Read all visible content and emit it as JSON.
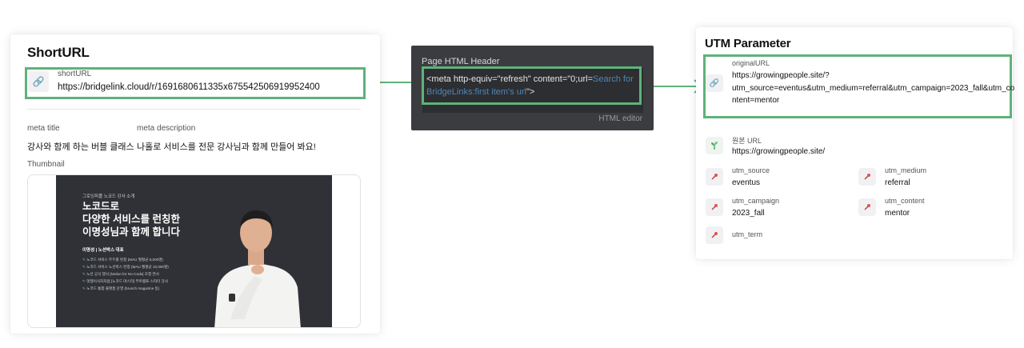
{
  "short_card": {
    "title": "ShortURL",
    "short_url": {
      "label": "shortURL",
      "value": "https://bridgelink.cloud/r/1691680611335x675542506919952400"
    },
    "meta_title": {
      "label": "meta title",
      "value": "강사와 함께 하는 버블 클래스"
    },
    "meta_description": {
      "label": "meta description",
      "value": "나홀로 서비스를 전문 강사님과 함께 만들어 봐요!"
    },
    "thumbnail": {
      "label": "Thumbnail",
      "eyebrow": "그로잉피플 노코드 강사 소개",
      "headline": [
        "노코드로",
        "다양한 서비스를 런칭한",
        "이명성님과 함께 합니다"
      ],
      "name": "이명성 | 노션박스 대표",
      "bullets": [
        "노코드 서비스 뚜두를 런칭 (MAU 월평균 5,000명)",
        "노코드 서비스 노션박스 런칭 (MAU 월평균 10,000명)",
        "노션 공식 행사 [Notion for No-Code] 초청 연사",
        "멋쟁이사자처럼 [노코드 마스터] 부트캠프 스타터 강사",
        "노코드 통합 플랫폼 운영 (brunch magazine 등)"
      ]
    }
  },
  "editor": {
    "title": "Page HTML Header",
    "code_plain": "<meta http-equiv=\"refresh\" content=\"0;url=",
    "code_link": "Search for BridgeLinks:first item's url",
    "code_end": "\">",
    "footer": "HTML editor"
  },
  "utm_card": {
    "title": "UTM Parameter",
    "original_url": {
      "label": "originalURL",
      "lines": [
        "https://growingpeople.site/?",
        "utm_source=eventus&utm_medium=referral&utm_campaign=2023_fall&utm_co",
        "ntent=mentor"
      ]
    },
    "origin_url": {
      "label": "원본 URL",
      "value": "https://growingpeople.site/"
    },
    "params": [
      {
        "label": "utm_source",
        "value": "eventus"
      },
      {
        "label": "utm_medium",
        "value": "referral"
      },
      {
        "label": "utm_campaign",
        "value": "2023_fall"
      },
      {
        "label": "utm_content",
        "value": "mentor"
      },
      {
        "label": "utm_term",
        "value": ""
      }
    ]
  },
  "icons": {
    "link": "link-icon",
    "sprout": "sprout-icon",
    "pin": "pin-icon"
  },
  "colors": {
    "highlight": "#5fb27a",
    "editor_bg": "#3b3c40",
    "editor_link": "#4f86b6"
  }
}
